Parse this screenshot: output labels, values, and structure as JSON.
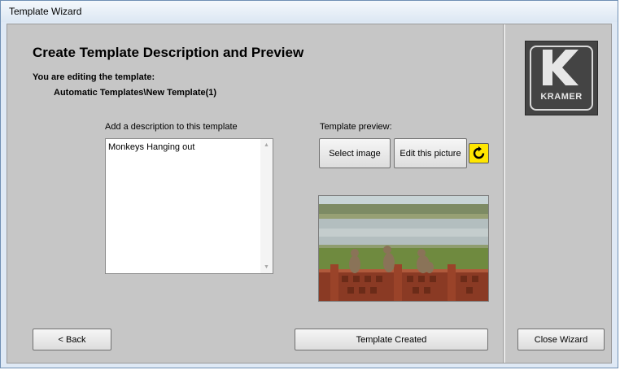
{
  "window": {
    "title": "Template Wizard"
  },
  "main": {
    "heading": "Create Template Description and Preview",
    "editing_label": "You are editing the template:",
    "template_path": "Automatic Templates\\New Template(1)",
    "description": {
      "label": "Add a description to this template",
      "value": "Monkeys Hanging out"
    },
    "preview": {
      "label": "Template preview:",
      "select_image_label": "Select image",
      "edit_picture_label": "Edit this picture",
      "refresh_icon": "refresh-icon",
      "image_content": "monkeys on a fence by a river"
    }
  },
  "footer": {
    "back_label": "< Back",
    "template_created_label": "Template Created",
    "close_wizard_label": "Close Wizard"
  },
  "logo": {
    "text": "KRAMER"
  },
  "colors": {
    "client_bg": "#c6c6c6",
    "refresh_button": "#ffe600",
    "logo_bg": "#444444"
  }
}
